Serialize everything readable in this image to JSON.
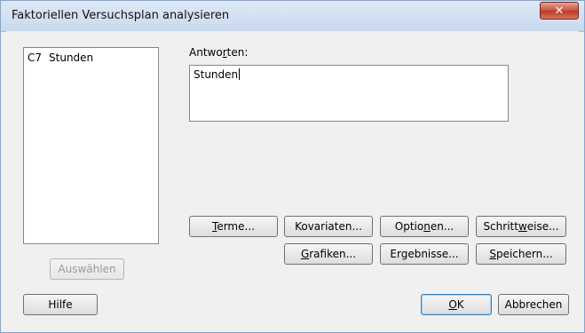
{
  "window": {
    "title": "Faktoriellen Versuchsplan analysieren",
    "close_glyph": "✕"
  },
  "variables": [
    {
      "column": "C7",
      "name": "Stunden"
    }
  ],
  "responses": {
    "label": "Antworten:",
    "value": "Stunden"
  },
  "buttons": {
    "terme": "Terme...",
    "kovariaten": "Kovariaten...",
    "optionen": "Optionen...",
    "schrittweise": "Schrittweise...",
    "grafiken": "Grafiken...",
    "ergebnisse": "Ergebnisse...",
    "speichern": "Speichern...",
    "auswaehlen": "Auswählen",
    "hilfe": "Hilfe",
    "ok": "OK",
    "abbrechen": "Abbrechen"
  }
}
